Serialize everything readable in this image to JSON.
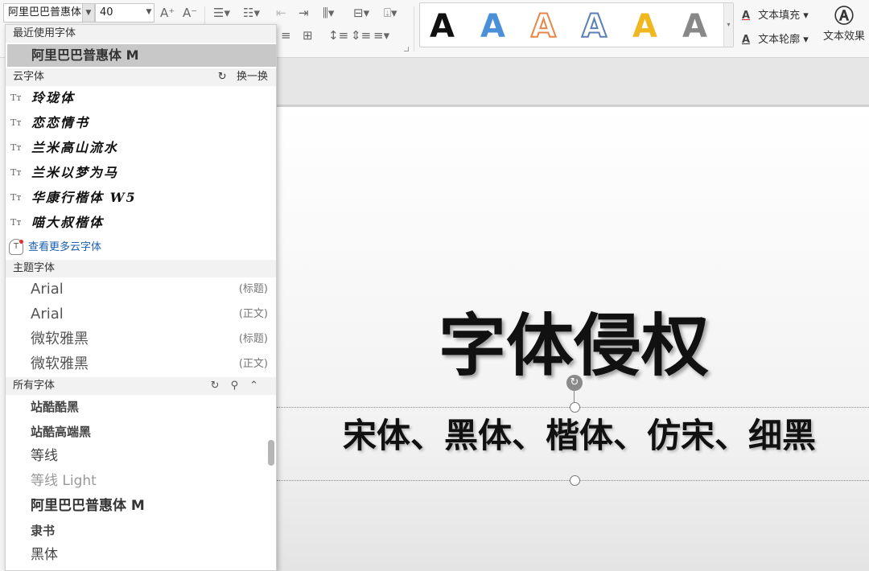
{
  "toolbar": {
    "font_name": "阿里巴巴普惠体M",
    "font_size": "40",
    "grow_font": "A⁺",
    "shrink_font": "A⁻",
    "text_fill_label": "文本填充",
    "text_outline_label": "文本轮廓",
    "text_effect_label": "文本效果",
    "style_letter": "A",
    "style_colors": [
      "#111111",
      "#4a90d9",
      "#e8864a",
      "#ffffff",
      "#f0b820",
      "#888888"
    ]
  },
  "panel": {
    "recent_header": "最近使用字体",
    "recent_item": "阿里巴巴普惠体 M",
    "cloud_header": "云字体",
    "cloud_refresh": "换一换",
    "cloud_fonts": [
      "玲珑体",
      "恋恋情书",
      "兰米高山流水",
      "兰米以梦为马",
      "华康行楷体 W5",
      "喵大叔楷体"
    ],
    "cloud_more": "查看更多云字体",
    "theme_header": "主题字体",
    "theme_fonts": [
      {
        "name": "Arial",
        "tag": "(标题)"
      },
      {
        "name": "Arial",
        "tag": "(正文)"
      },
      {
        "name": "微软雅黑",
        "tag": "(标题)"
      },
      {
        "name": "微软雅黑",
        "tag": "(正文)"
      }
    ],
    "all_header": "所有字体",
    "all_fonts": [
      "站酷酷黑",
      "站酷高端黑",
      "等线",
      "等线 Light",
      "阿里巴巴普惠体 M",
      "隶书",
      "黑体"
    ]
  },
  "slide": {
    "title": "字体侵权",
    "subtitle": "宋体、黑体、楷体、仿宋、细黑"
  }
}
